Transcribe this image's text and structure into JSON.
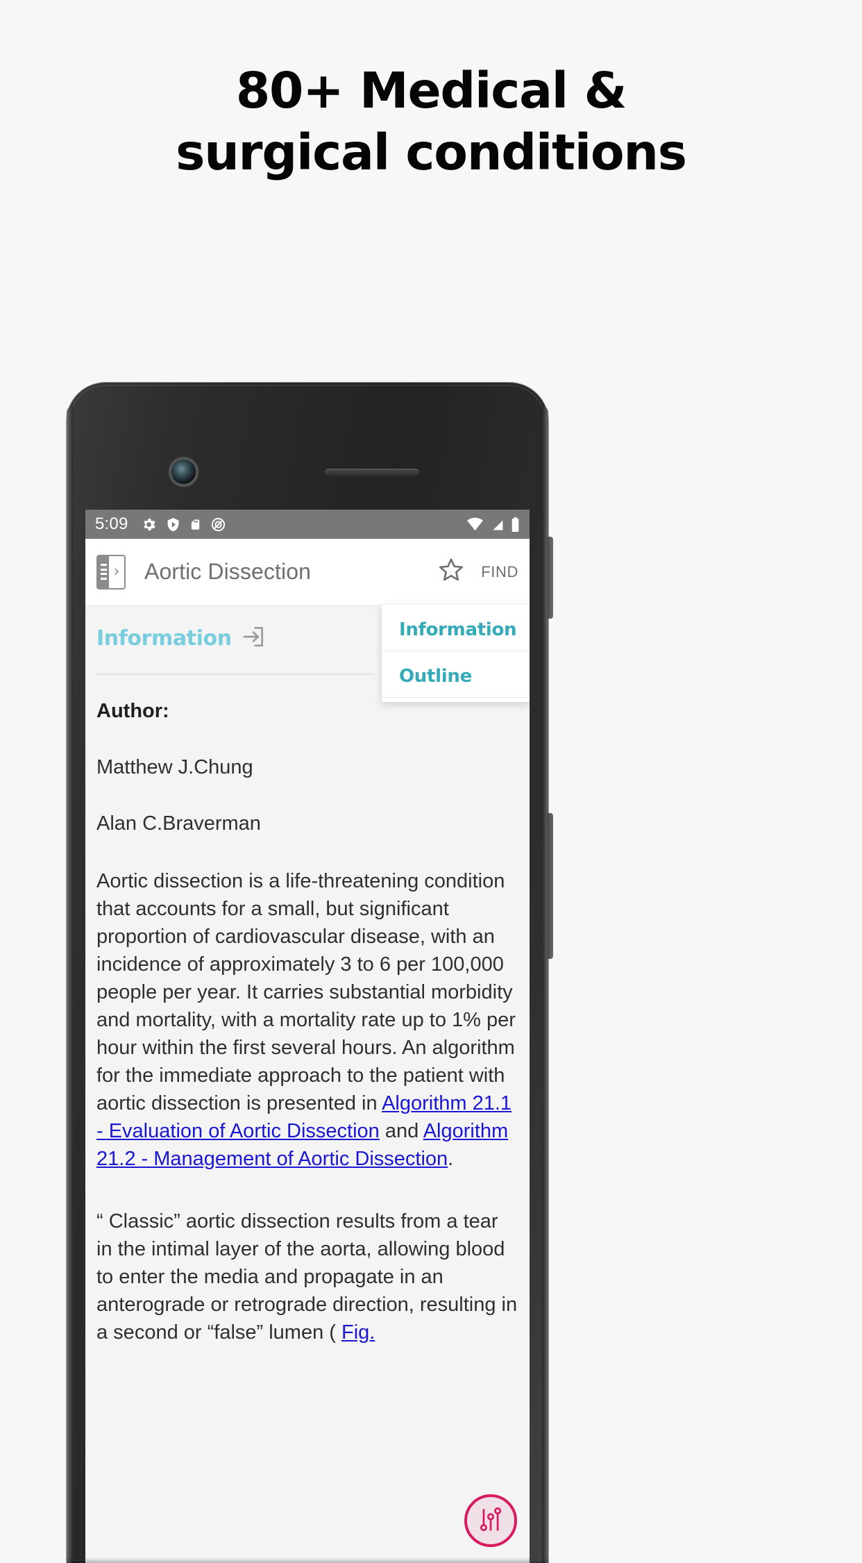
{
  "promo": {
    "headline_line1": "80+ Medical &",
    "headline_line2": "surgical conditions"
  },
  "colors": {
    "accent_teal": "#35aab8",
    "tab_teal": "#79cede",
    "link_blue": "#1a17d4",
    "fab_pink": "#d81b60",
    "statusbar_gray": "#787878",
    "content_bg": "#f4f4f4",
    "page_bg": "#f7f7f7"
  },
  "phone": {
    "statusbar": {
      "time": "5:09",
      "left_icons": [
        "gear-icon",
        "play-shield-icon",
        "sd-card-icon",
        "do-not-disturb-icon"
      ],
      "right_icons": [
        "wifi-icon",
        "signal-no-service-icon",
        "battery-icon"
      ]
    },
    "toolbar": {
      "drawer_icon": "navigation-drawer-icon",
      "title": "Aortic Dissection",
      "favorite_icon": "star-outline-icon",
      "find_label": "FIND"
    },
    "tabs": {
      "active_label": "Information",
      "active_icon": "login-arrow-icon",
      "dropdown": {
        "items": [
          {
            "label": "Information"
          },
          {
            "label": "Outline"
          }
        ]
      }
    },
    "content": {
      "author_heading": "Author:",
      "authors": [
        "Matthew J.Chung",
        "Alan C.Braverman"
      ],
      "paragraph1_before_links": "Aortic dissection is a life-threatening condition that accounts for a small, but significant proportion of cardiovascular disease, with an incidence of approximately 3 to 6 per 100,000 people per year. It carries substantial morbidity and mortality, with a mortality rate up to 1% per hour within the first several hours. An algorithm for the immediate approach to the patient with aortic dissection is presented in ",
      "link1": "Algorithm 21.1 - Evaluation of Aortic Dissection",
      "paragraph1_between_links": " and ",
      "link2": "Algorithm 21.2 - Management of Aortic Dissection",
      "paragraph1_after_links": ".",
      "paragraph2_before_link": "“ Classic” aortic dissection results from a tear in the intimal layer of the aorta, allowing blood to enter the media and propagate in an anterograde or retrograde direction, resulting in a second or “false” lumen ( ",
      "paragraph2_link": "Fig."
    },
    "fab": {
      "icon": "tune-sliders-icon"
    }
  }
}
